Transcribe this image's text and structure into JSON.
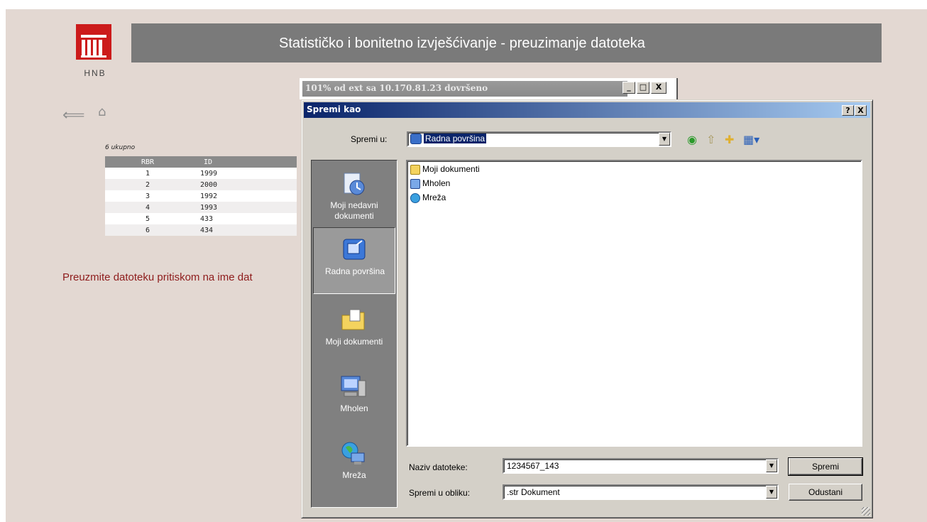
{
  "page": {
    "logo_text": "HNB",
    "header_title": "Statističko i bonitetno izvješćivanje - preuzimanje datoteka",
    "nav": {
      "back_icon": "back-arrow-icon",
      "home_icon": "home-icon"
    },
    "count_label": "6 ukupno",
    "table": {
      "headers": [
        "RBR",
        "ID"
      ],
      "rows": [
        [
          "1",
          "1999"
        ],
        [
          "2",
          "2000"
        ],
        [
          "3",
          "1992"
        ],
        [
          "4",
          "1993"
        ],
        [
          "5",
          "433"
        ],
        [
          "6",
          "434"
        ]
      ]
    },
    "instruction": "Preuzmite datoteku pritiskom na ime dat"
  },
  "progress_window": {
    "title": "101% od ext sa 10.170.81.23 dovršeno",
    "buttons": [
      "_",
      "□",
      "X"
    ]
  },
  "dialog": {
    "title": "Spremi kao",
    "title_buttons": [
      "?",
      "X"
    ],
    "save_in_label": "Spremi u:",
    "save_in_value": "Radna površina",
    "toolbar_icons": [
      "back-icon",
      "up-folder-icon",
      "new-folder-icon",
      "view-menu-icon"
    ],
    "places": [
      {
        "icon": "recent-documents-icon",
        "label": "Moji nedavni dokumenti"
      },
      {
        "icon": "desktop-icon",
        "label": "Radna površina"
      },
      {
        "icon": "my-documents-icon",
        "label": "Moji dokumenti"
      },
      {
        "icon": "my-computer-icon",
        "label": "Mholen"
      },
      {
        "icon": "network-icon",
        "label": "Mreža"
      }
    ],
    "files": [
      {
        "icon": "folder-icon",
        "name": "Moji dokumenti"
      },
      {
        "icon": "user-computer-icon",
        "name": "Mholen"
      },
      {
        "icon": "network-icon",
        "name": "Mreža"
      }
    ],
    "filename_label": "Naziv datoteke:",
    "filename_value": "1234567_143",
    "filetype_label": "Spremi u obliku:",
    "filetype_value": ".str Dokument",
    "save_button": "Spremi",
    "cancel_button": "Odustani"
  },
  "colors": {
    "page_bg": "#e3d8d2",
    "header_bg": "#7a7a7a",
    "logo_red": "#cc1b1b",
    "instruction_red": "#8e1c1c",
    "dialog_title_start": "#0a246a",
    "dialog_title_end": "#a6caf0"
  }
}
